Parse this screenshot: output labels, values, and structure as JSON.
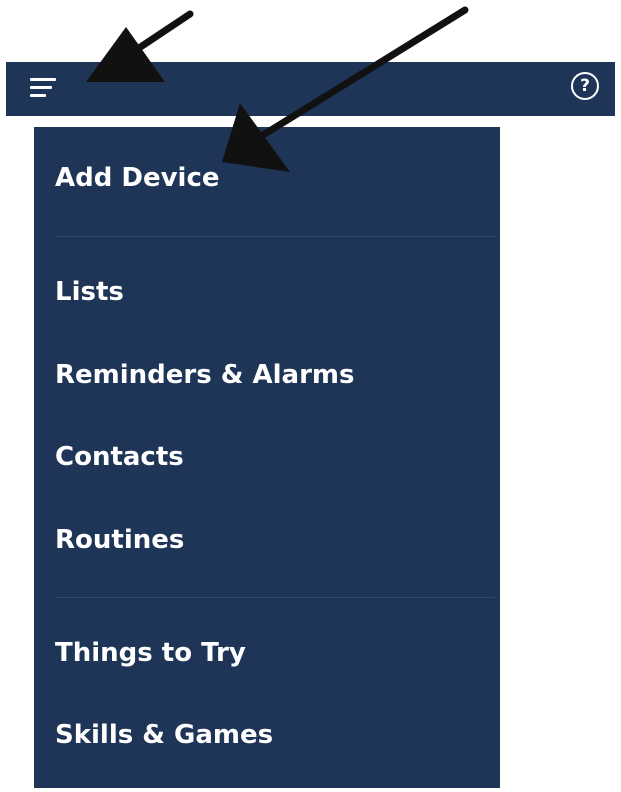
{
  "topbar": {
    "menu_icon": "hamburger-icon",
    "help_icon": "help-question-icon",
    "help_glyph": "?"
  },
  "menu": {
    "items": [
      {
        "label": "Add Device"
      },
      {
        "label": "Lists"
      },
      {
        "label": "Reminders & Alarms"
      },
      {
        "label": "Contacts"
      },
      {
        "label": "Routines"
      },
      {
        "label": "Things to Try"
      },
      {
        "label": "Skills & Games"
      }
    ]
  },
  "colors": {
    "navy": "#1f3557",
    "text": "#ffffff",
    "divider": "#2f4a70",
    "arrow": "#111111"
  }
}
